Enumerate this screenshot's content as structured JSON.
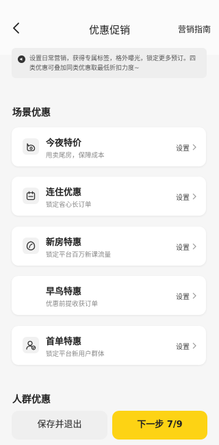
{
  "header": {
    "title": "优惠促销",
    "guide_link": "营销指南"
  },
  "notice": {
    "text": "设置日常营销，获得专属标签，格外曝光，锁定更多预订。四类优惠可叠加同类优惠取最低折扣力度~"
  },
  "sections": [
    {
      "title": "场景优惠"
    },
    {
      "title": "人群优惠"
    }
  ],
  "cards": [
    {
      "title": "今夜特价",
      "desc": "甩卖尾房，保障成本",
      "action": "设置",
      "icon": "moon-icon"
    },
    {
      "title": "连住优惠",
      "desc": "锁定省心长订单",
      "action": "设置",
      "icon": "calendar-icon"
    },
    {
      "title": "新房特惠",
      "desc": "锁定平台百万新课流量",
      "action": "设置",
      "icon": "leaf-icon"
    },
    {
      "title": "早鸟特惠",
      "desc": "优惠前提收获订单",
      "action": "设置",
      "icon": "bird-icon"
    },
    {
      "title": "首单特惠",
      "desc": "锁定平台新用户群体",
      "action": "设置",
      "icon": "user-check-icon"
    }
  ],
  "footer": {
    "save_label": "保存并退出",
    "next_label": "下一步 7/9"
  },
  "colors": {
    "accent": "#fdd314",
    "background": "#f6f6f6",
    "card": "#ffffff"
  }
}
